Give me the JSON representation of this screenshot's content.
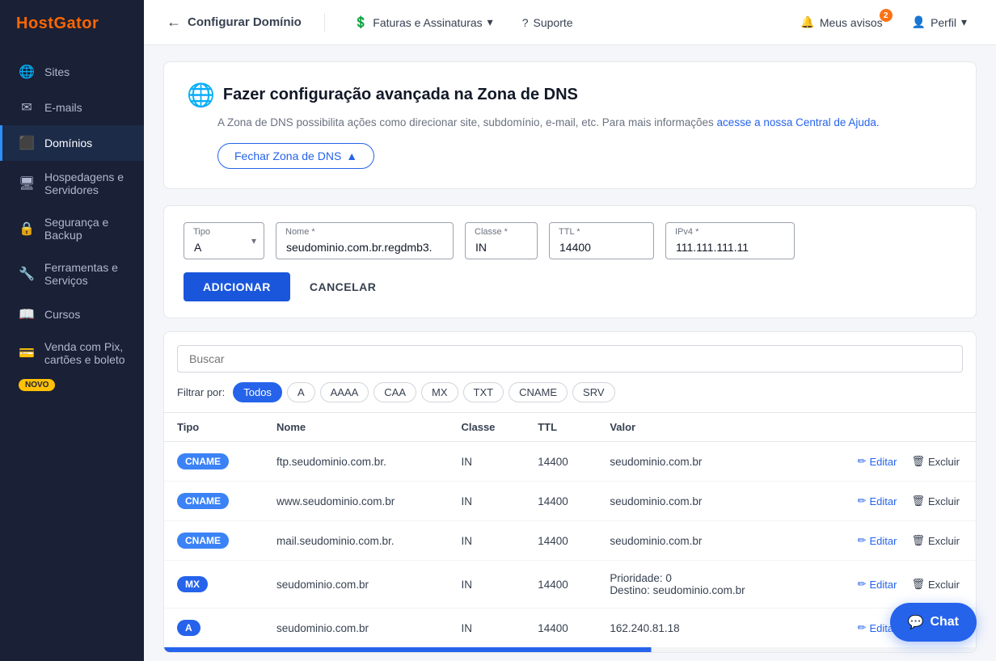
{
  "brand": {
    "name": "HostGator"
  },
  "sidebar": {
    "items": [
      {
        "id": "sites",
        "label": "Sites",
        "icon": "🌐"
      },
      {
        "id": "emails",
        "label": "E-mails",
        "icon": "✉"
      },
      {
        "id": "dominios",
        "label": "Domínios",
        "icon": "🔷",
        "active": true
      },
      {
        "id": "hospedagens",
        "label": "Hospedagens e Servidores",
        "icon": "🖥"
      },
      {
        "id": "seguranca",
        "label": "Segurança e Backup",
        "icon": "🔒"
      },
      {
        "id": "ferramentas",
        "label": "Ferramentas e Serviços",
        "icon": "🔧"
      },
      {
        "id": "cursos",
        "label": "Cursos",
        "icon": "📖"
      },
      {
        "id": "venda",
        "label": "Venda com Pix, cartões e boleto",
        "icon": "💳",
        "badge": "NOVO"
      }
    ]
  },
  "topnav": {
    "back_label": "Configurar Domínio",
    "faturas_label": "Faturas e Assinaturas",
    "suporte_label": "Suporte",
    "avisos_label": "Meus avisos",
    "avisos_count": "2",
    "perfil_label": "Perfil"
  },
  "dns_section": {
    "title": "Fazer configuração avançada na Zona de DNS",
    "description": "A Zona de DNS possibilita ações como direcionar site, subdomínio, e-mail, etc. Para mais informações",
    "link_text": "acesse a nossa Central de Ajuda.",
    "fechar_label": "Fechar Zona de DNS"
  },
  "form": {
    "tipo_label": "Tipo",
    "tipo_value": "A",
    "nome_label": "Nome *",
    "nome_value": "seudominio.com.br.regdmb3.",
    "classe_label": "Classe *",
    "classe_value": "IN",
    "ttl_label": "TTL *",
    "ttl_value": "14400",
    "ipv4_label": "IPv4 *",
    "ipv4_value": "111.111.111.11",
    "adicionar_label": "ADICIONAR",
    "cancelar_label": "CANCELAR"
  },
  "table": {
    "search_placeholder": "Buscar",
    "filter_label": "Filtrar por:",
    "filters": [
      "Todos",
      "A",
      "AAAA",
      "CAA",
      "MX",
      "TXT",
      "CNAME",
      "SRV"
    ],
    "active_filter": "Todos",
    "columns": [
      "Tipo",
      "Nome",
      "Classe",
      "TTL",
      "Valor"
    ],
    "rows": [
      {
        "tipo": "CNAME",
        "tipo_class": "type-cname",
        "nome": "ftp.seudominio.com.br.",
        "classe": "IN",
        "ttl": "14400",
        "valor": "seudominio.com.br"
      },
      {
        "tipo": "CNAME",
        "tipo_class": "type-cname",
        "nome": "www.seudominio.com.br",
        "classe": "IN",
        "ttl": "14400",
        "valor": "seudominio.com.br"
      },
      {
        "tipo": "CNAME",
        "tipo_class": "type-cname",
        "nome": "mail.seudominio.com.br.",
        "classe": "IN",
        "ttl": "14400",
        "valor": "seudominio.com.br"
      },
      {
        "tipo": "MX",
        "tipo_class": "type-mx",
        "nome": "seudominio.com.br",
        "classe": "IN",
        "ttl": "14400",
        "valor": "Prioridade: 0\nDestino: seudominio.com.br"
      },
      {
        "tipo": "A",
        "tipo_class": "type-a",
        "nome": "seudominio.com.br",
        "classe": "IN",
        "ttl": "14400",
        "valor": "162.240.81.18"
      }
    ],
    "edit_label": "Editar",
    "delete_label": "Excluir"
  },
  "chat": {
    "label": "Chat"
  }
}
